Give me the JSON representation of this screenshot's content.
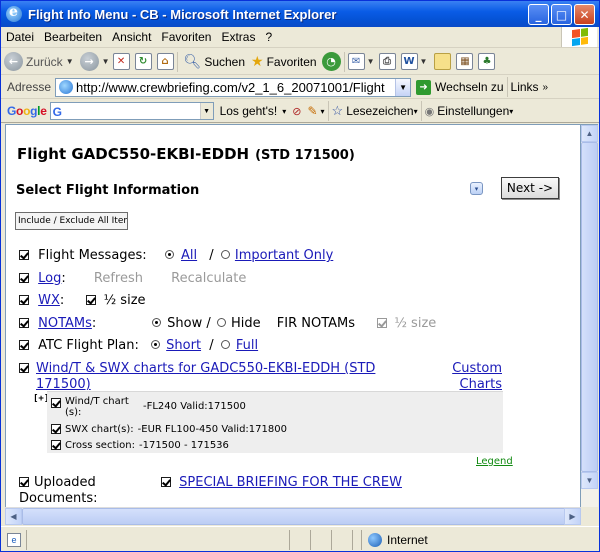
{
  "window": {
    "title": "Flight Info Menu - CB - Microsoft Internet Explorer",
    "min_glyph": "_",
    "max_glyph": "□",
    "close_glyph": "✕"
  },
  "menubar": {
    "items": [
      "Datei",
      "Bearbeiten",
      "Ansicht",
      "Favoriten",
      "Extras",
      "?"
    ]
  },
  "toolbar": {
    "back_label": "Zurück",
    "search_label": "Suchen",
    "favorites_label": "Favoriten"
  },
  "address": {
    "label": "Adresse",
    "url": "http://www.crewbriefing.com/v2_1_6_20071001/Flight",
    "go_label": "Wechseln zu",
    "links_label": "Links"
  },
  "googlebar": {
    "logo": "Google",
    "search_value": "G",
    "go_label": "Los geht's!",
    "bookmarks_label": "Lesezeichen",
    "settings_label": "Einstellungen"
  },
  "page": {
    "flight_label": "Flight GADC550-EKBI-EDDH",
    "std_label": "(STD 171500)",
    "section_title": "Select Flight Information",
    "next_button": "Next ->",
    "include_exclude_button": "Include / Exclude All Items",
    "messages": {
      "label": "Flight Messages:",
      "opt_all": "All",
      "slash": "/",
      "opt_important": "Important Only"
    },
    "log": {
      "label": "Log",
      "colon": ":",
      "refresh": "Refresh",
      "recalculate": "Recalculate"
    },
    "wx": {
      "label": "WX",
      "colon": ":",
      "half_size": "½ size"
    },
    "notams": {
      "label": "NOTAMs",
      "colon": ":",
      "opt_show": "Show /",
      "opt_hide": "Hide",
      "fir_notams": "FIR NOTAMs",
      "half_size": "½ size"
    },
    "atc": {
      "label": "ATC Flight Plan:",
      "opt_short": "Short",
      "slash": "/",
      "opt_full": "Full"
    },
    "windt": {
      "link_line1": "Wind/T & SWX charts for GADC550-EKBI-EDDH (STD",
      "link_line2": "171500)",
      "custom_line1": "Custom",
      "custom_line2": "Charts",
      "expander": "[+]",
      "rows": [
        {
          "label1": "Wind/T chart",
          "label2": "(s):",
          "value": "-FL240 Valid:171500"
        },
        {
          "label1": "SWX chart(s):",
          "label2": "",
          "value": "-EUR FL100-450 Valid:171800"
        },
        {
          "label1": "Cross section:",
          "label2": "",
          "value": "-171500 - 171536"
        }
      ],
      "legend": "Legend"
    },
    "uploaded": {
      "label_line1": "Uploaded",
      "label_line2": "Documents:",
      "special_briefing": "SPECIAL BRIEFING FOR THE CREW"
    }
  },
  "statusbar": {
    "zone": "Internet"
  },
  "colors": {
    "link": "#1a1ab8",
    "legend_link": "#118a11",
    "titlebar": "#0a5ce6"
  }
}
